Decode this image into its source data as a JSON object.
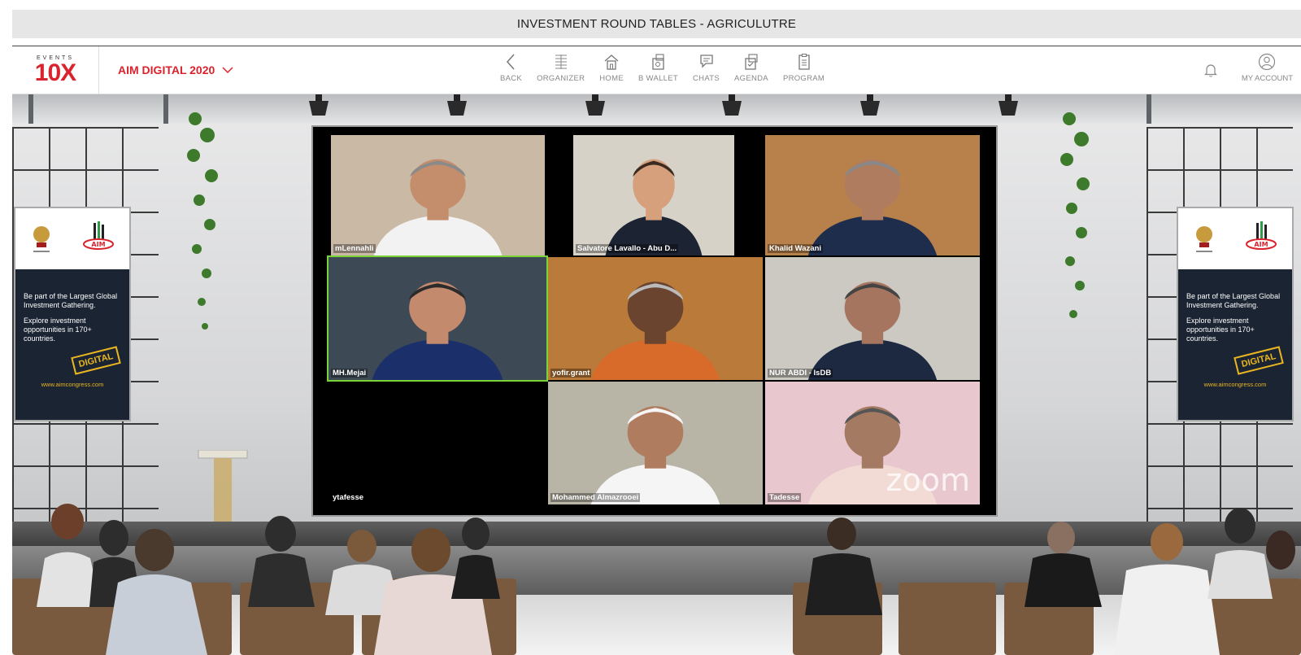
{
  "window": {
    "title": "INVESTMENT ROUND TABLES - AGRICULUTRE"
  },
  "brand": {
    "logo_small": "EVENTS",
    "logo_main": "10X",
    "accent": "#d9232d"
  },
  "event_selector": {
    "label": "AIM DIGITAL 2020",
    "icon": "chevron-down-icon"
  },
  "nav": {
    "back": "BACK",
    "organizer": "ORGANIZER",
    "home": "HOME",
    "wallet": "B WALLET",
    "chats": "CHATS",
    "agenda": "AGENDA",
    "program": "PROGRAM",
    "account": "MY ACCOUNT"
  },
  "banner": {
    "line1": "Be part of the Largest Global Investment Gathering.",
    "line2": "Explore investment opportunities in 170+ countries.",
    "stamp": "DIGITAL",
    "url": "www.aimcongress.com",
    "logo_text": "AIM"
  },
  "participants": [
    {
      "name": "mLennahli",
      "bg": "#c9b9a5",
      "skin": "#c48e6c",
      "shirt": "#f2f2f2",
      "hair": "#8a8a8a",
      "active": false
    },
    {
      "name": "Salvatore Lavallo - Abu D...",
      "bg": "#d6d2c8",
      "skin": "#d6a07c",
      "shirt": "#1c2433",
      "hair": "#3b2a1f",
      "active": false
    },
    {
      "name": "Khalid Wazani",
      "bg": "#b8814c",
      "skin": "#b07c5f",
      "shirt": "#1f2d4d",
      "hair": "#888888",
      "active": false
    },
    {
      "name": "MH.Mejai",
      "bg": "#3d4a55",
      "skin": "#c48a6e",
      "shirt": "#1b2f6b",
      "hair": "#2b2b2b",
      "active": true
    },
    {
      "name": "yofir.grant",
      "bg": "#b97a3a",
      "skin": "#6b4430",
      "shirt": "#d86a2a",
      "hair": "#bbbbbb",
      "active": false
    },
    {
      "name": "NUR ABDI - IsDB",
      "bg": "#cbc9c2",
      "skin": "#a57560",
      "shirt": "#1d2940",
      "hair": "#444444",
      "active": false
    },
    {
      "name": "ytafesse",
      "bg": "#000000",
      "skin": "",
      "shirt": "",
      "hair": "",
      "active": false
    },
    {
      "name": "Mohammed Almazrooei",
      "bg": "#b8b5a6",
      "skin": "#b07c5f",
      "shirt": "#f5f5f5",
      "hair": "#f5f5f5",
      "active": false
    },
    {
      "name": "Tadesse",
      "bg": "#e8c7cf",
      "skin": "#a47a62",
      "shirt": "#f2dad5",
      "hair": "#555555",
      "active": false
    }
  ],
  "zoom_watermark": "zoom"
}
